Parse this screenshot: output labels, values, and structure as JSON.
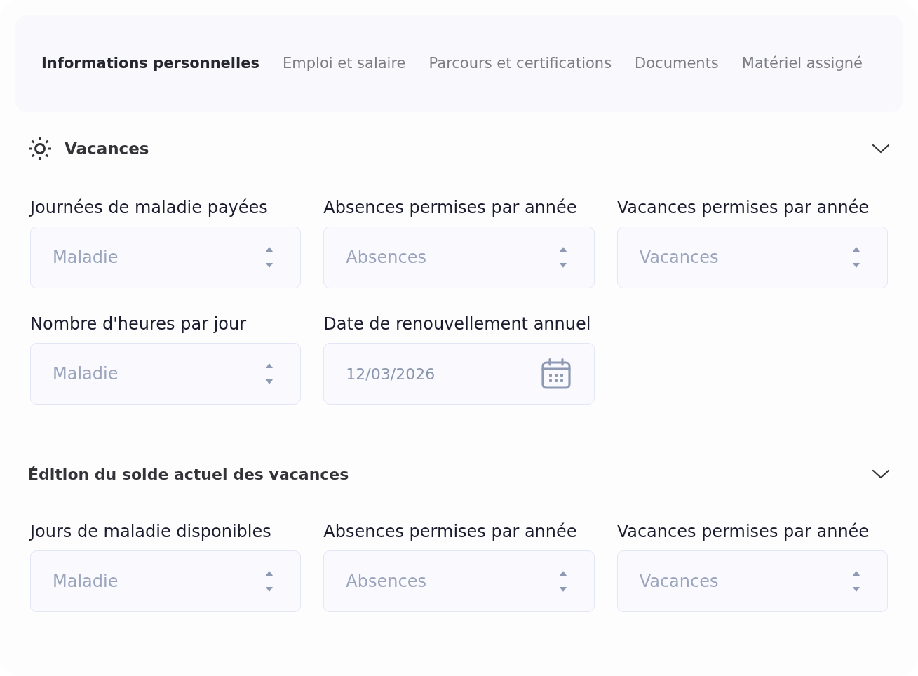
{
  "tabs": [
    {
      "label": "Informations personnelles",
      "selected": true
    },
    {
      "label": "Emploi et salaire",
      "selected": false
    },
    {
      "label": "Parcours et certifications",
      "selected": false
    },
    {
      "label": "Documents",
      "selected": false
    },
    {
      "label": "Matériel assigné",
      "selected": false
    }
  ],
  "sections": [
    {
      "title": "Vacances",
      "kind": "with-icon",
      "expanded": true,
      "fields": [
        {
          "kind": "number",
          "label": "Journées de maladie payées",
          "placeholder": "Maladie"
        },
        {
          "kind": "number",
          "label": "Absences permises par année",
          "placeholder": "Absences"
        },
        {
          "kind": "number",
          "label": "Vacances permises par année",
          "placeholder": "Vacances"
        },
        {
          "kind": "number",
          "label": "Nombre d'heures par jour",
          "placeholder": "Maladie"
        },
        {
          "kind": "date",
          "label": "Date de renouvellement annuel",
          "value": "12/03/2026"
        }
      ]
    },
    {
      "title": "Édition du solde actuel des vacances",
      "kind": "plain",
      "expanded": true,
      "fields": [
        {
          "kind": "number",
          "label": "Jours de maladie disponibles",
          "placeholder": "Maladie"
        },
        {
          "kind": "number",
          "label": "Absences permises par année",
          "placeholder": "Absences"
        },
        {
          "kind": "number",
          "label": "Vacances permises par année",
          "placeholder": "Vacances"
        }
      ]
    }
  ]
}
